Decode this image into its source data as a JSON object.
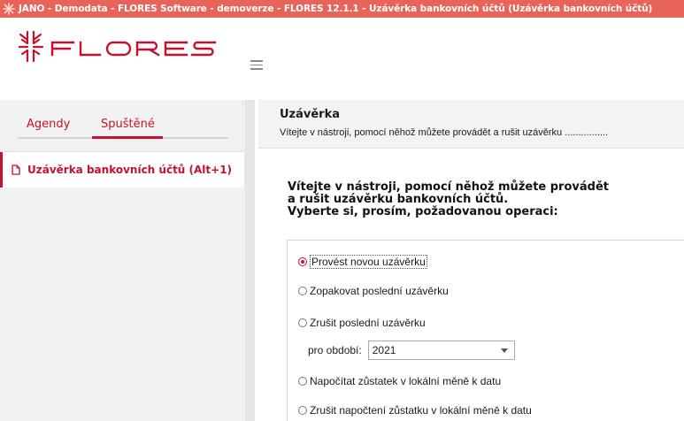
{
  "window": {
    "title": "JANO - Demodata - FLORES Software - demoverze - FLORES 12.1.1 - Uzávěrka bankovních účtů  (Uzávěrka bankovních účtů)"
  },
  "brand": {
    "logo_text": "FLORES",
    "accent_color": "#c8102e",
    "titlebar_color": "#e8645a"
  },
  "sidebar": {
    "tabs": [
      {
        "label": "Agendy",
        "active": false
      },
      {
        "label": "Spuštěné",
        "active": true
      }
    ],
    "running": [
      {
        "label": "Uzávěrka bankovních účtů (Alt+1)",
        "icon": "document-icon"
      }
    ]
  },
  "page": {
    "title": "Uzávěrka",
    "subtitle": "Vítejte v nástroji, pomocí něhož můžete provádět a rušit uzávěrku ................",
    "welcome_lines": [
      "Vítejte v nástroji, pomocí něhož můžete provádět",
      "a rušit uzávěrku bankovních účtů.",
      "Vyberte si, prosím, požadovanou operaci:"
    ],
    "options": [
      {
        "label": "Provést novou uzávěrku",
        "checked": true
      },
      {
        "label": "Zopakovat poslední uzávěrku",
        "checked": false
      },
      {
        "label": "Zrušit poslední uzávěrku",
        "checked": false
      },
      {
        "label": "Napočítat zůstatek v lokální měně k datu",
        "checked": false
      },
      {
        "label": "Zrušit napočtení zůstatku v lokální měně k datu",
        "checked": false
      }
    ],
    "period": {
      "label": "pro období:",
      "value": "2021"
    }
  }
}
